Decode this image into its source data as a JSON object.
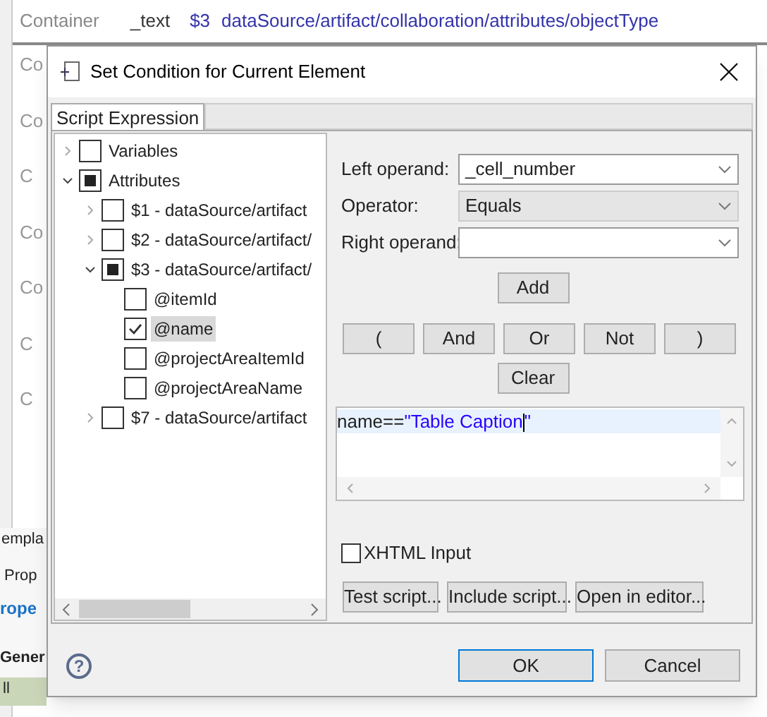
{
  "background": {
    "header": {
      "label": "Container",
      "field": "_text",
      "index": "$3",
      "path": "dataSource/artifact/collaboration/attributes/objectType"
    },
    "fragments": [
      "Co",
      "Co",
      "C",
      "Co",
      "Co",
      "C",
      "C"
    ],
    "tabs": [
      "empla",
      "Prop",
      "rope"
    ],
    "section": "Gener",
    "row": "ll"
  },
  "dialog": {
    "title": "Set Condition for Current Element",
    "tabs": [
      {
        "label": "Script Expression",
        "selected": true
      }
    ],
    "tree": [
      {
        "label": "Variables",
        "checked": false,
        "mixed": false,
        "expanded": false
      },
      {
        "label": "Attributes",
        "checked": false,
        "mixed": true,
        "expanded": true,
        "children": [
          {
            "label": "$1 - dataSource/artifact",
            "checked": false,
            "mixed": false,
            "expanded": false
          },
          {
            "label": "$2 - dataSource/artifact/",
            "checked": false,
            "mixed": false,
            "expanded": false
          },
          {
            "label": "$3 - dataSource/artifact/",
            "checked": false,
            "mixed": true,
            "expanded": true,
            "children": [
              {
                "label": "@itemId",
                "checked": false,
                "mixed": false,
                "selected": false
              },
              {
                "label": "@name",
                "checked": true,
                "mixed": false,
                "selected": true
              },
              {
                "label": "@projectAreaItemId",
                "checked": false,
                "mixed": false,
                "selected": false
              },
              {
                "label": "@projectAreaName",
                "checked": false,
                "mixed": false,
                "selected": false
              }
            ]
          },
          {
            "label": "$7 - dataSource/artifact",
            "checked": false,
            "mixed": false,
            "expanded": false
          }
        ]
      }
    ],
    "fields": [
      {
        "label": "Left operand:",
        "value": "_cell_number",
        "disabled": false
      },
      {
        "label": "Operator:",
        "value": "Equals",
        "disabled": true
      },
      {
        "label": "Right operand:",
        "disabled": false
      }
    ],
    "add": "Add",
    "operators": [
      "(",
      "And",
      "Or",
      "Not",
      ")"
    ],
    "clear": "Clear",
    "script": [
      {
        "text": "name==",
        "kind": "plain"
      },
      {
        "text": "\"Table Caption",
        "kind": "string"
      },
      {
        "text": "\"",
        "kind": "string"
      }
    ],
    "xhtml": {
      "label": "XHTML Input",
      "checked": false
    },
    "script_buttons": [
      "Test script...",
      "Include script...",
      "Open in editor..."
    ],
    "help": "?",
    "ok": "OK",
    "cancel": "Cancel"
  }
}
